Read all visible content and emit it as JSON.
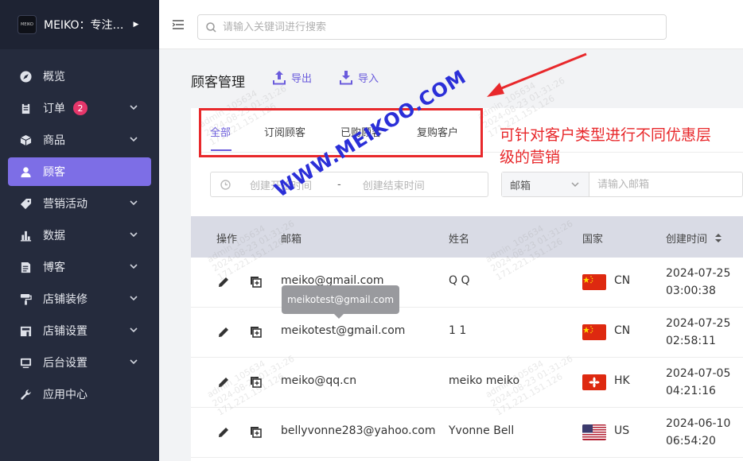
{
  "sidebar": {
    "brand_logo_text": "MEIKO",
    "brand_name": "MEIKO：专注…",
    "items": [
      {
        "label": "概览",
        "icon": "compass-icon"
      },
      {
        "label": "订单",
        "icon": "clipboard-icon",
        "badge": "2"
      },
      {
        "label": "商品",
        "icon": "box-icon"
      },
      {
        "label": "顾客",
        "icon": "user-icon"
      },
      {
        "label": "营销活动",
        "icon": "tag-icon"
      },
      {
        "label": "数据",
        "icon": "bar-chart-icon"
      },
      {
        "label": "博客",
        "icon": "document-icon"
      },
      {
        "label": "店铺装修",
        "icon": "paint-roller-icon"
      },
      {
        "label": "店铺设置",
        "icon": "store-icon"
      },
      {
        "label": "后台设置",
        "icon": "monitor-icon"
      },
      {
        "label": "应用中心",
        "icon": "wrench-icon"
      }
    ],
    "active_item": "顾客"
  },
  "topbar": {
    "search_placeholder": "请输入关键词进行搜索"
  },
  "page": {
    "title": "顾客管理",
    "export_label": "导出",
    "import_label": "导入"
  },
  "tabs": [
    "全部",
    "订阅顾客",
    "已购顾客",
    "复购客户"
  ],
  "active_tab": "全部",
  "filters": {
    "date_start_placeholder": "创建开始时间",
    "date_separator": "-",
    "date_end_placeholder": "创建结束时间",
    "email_select": "邮箱",
    "email_placeholder": "请输入邮箱"
  },
  "table": {
    "headers": {
      "action": "操作",
      "email": "邮箱",
      "name": "姓名",
      "country": "国家",
      "created": "创建时间"
    },
    "rows": [
      {
        "email": "meiko@gmail.com",
        "name": "Q Q",
        "country": "CN",
        "date": "2024-07-25",
        "time": "03:00:38"
      },
      {
        "email": "meikotest@gmail.com",
        "name": "1 1",
        "country": "CN",
        "date": "2024-07-25",
        "time": "02:58:11"
      },
      {
        "email": "meiko@qq.cn",
        "name": "meiko meiko",
        "country": "HK",
        "date": "2024-07-05",
        "time": "04:21:16"
      },
      {
        "email": "bellyvonne283@yahoo.com",
        "name": "Yvonne Bell",
        "country": "US",
        "date": "2024-06-10",
        "time": "06:54:20"
      }
    ]
  },
  "tooltip": "meikotest@gmail.com",
  "annotation": {
    "line1": "可针对客户类型进行不同优惠层",
    "line2": "级的营销"
  },
  "watermark": "WWW.MEIKOO.COM",
  "ghost_watermark": {
    "line1": "admin_105634",
    "line2": "2024-08-23 01:31:26",
    "line3": "171.221.151.126"
  },
  "colors": {
    "sidebar_bg": "#252b3d",
    "accent": "#7d6ee6",
    "badge": "#e5366a",
    "annotation": "#e8282b"
  }
}
